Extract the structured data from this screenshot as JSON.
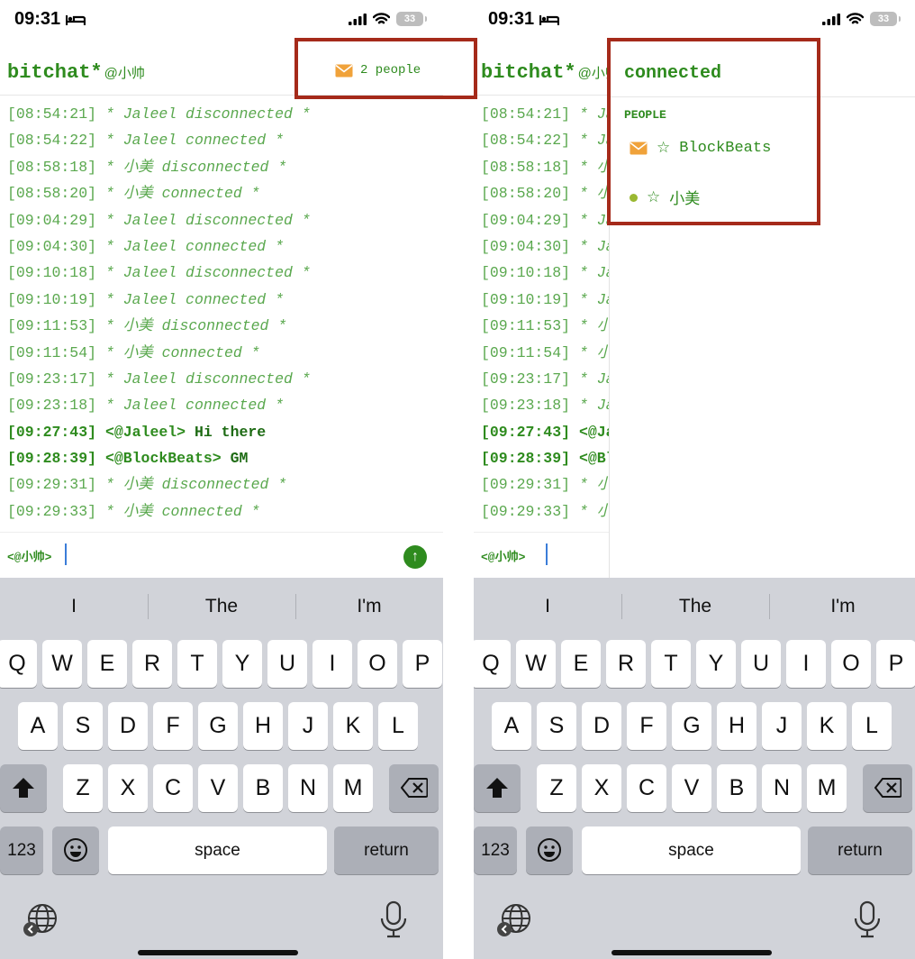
{
  "status": {
    "time": "09:31",
    "battery": "33"
  },
  "header": {
    "app_name": "bitchat*",
    "handle": "@小帅",
    "people_label": "2 people"
  },
  "messages": [
    {
      "ts": "[08:54:21]",
      "text": "* Jaleel disconnected *",
      "kind": "sys"
    },
    {
      "ts": "[08:54:22]",
      "text": "* Jaleel connected *",
      "kind": "sys"
    },
    {
      "ts": "[08:58:18]",
      "text": "* 小美 disconnected *",
      "kind": "sys"
    },
    {
      "ts": "[08:58:20]",
      "text": "* 小美 connected *",
      "kind": "sys"
    },
    {
      "ts": "[09:04:29]",
      "text": "* Jaleel disconnected *",
      "kind": "sys"
    },
    {
      "ts": "[09:04:30]",
      "text": "* Jaleel connected *",
      "kind": "sys"
    },
    {
      "ts": "[09:10:18]",
      "text": "* Jaleel disconnected *",
      "kind": "sys"
    },
    {
      "ts": "[09:10:19]",
      "text": "* Jaleel connected *",
      "kind": "sys"
    },
    {
      "ts": "[09:11:53]",
      "text": "* 小美 disconnected *",
      "kind": "sys"
    },
    {
      "ts": "[09:11:54]",
      "text": "* 小美 connected *",
      "kind": "sys"
    },
    {
      "ts": "[09:23:17]",
      "text": "* Jaleel disconnected *",
      "kind": "sys"
    },
    {
      "ts": "[09:23:18]",
      "text": "* Jaleel connected *",
      "kind": "sys"
    },
    {
      "ts": "[09:27:43]",
      "nick": "<@Jaleel>",
      "text": "Hi there",
      "kind": "chat"
    },
    {
      "ts": "[09:28:39]",
      "nick": "<@BlockBeats>",
      "text": "GM",
      "kind": "chat"
    },
    {
      "ts": "[09:29:31]",
      "text": "* 小美 disconnected *",
      "kind": "sys"
    },
    {
      "ts": "[09:29:33]",
      "text": "* 小美 connected *",
      "kind": "sys"
    }
  ],
  "input": {
    "prompt": "<@小帅>"
  },
  "suggestions": [
    "I",
    "The",
    "I'm"
  ],
  "keyboard": {
    "row1": [
      "Q",
      "W",
      "E",
      "R",
      "T",
      "Y",
      "U",
      "I",
      "O",
      "P"
    ],
    "row2": [
      "A",
      "S",
      "D",
      "F",
      "G",
      "H",
      "J",
      "K",
      "L"
    ],
    "row3": [
      "Z",
      "X",
      "C",
      "V",
      "B",
      "N",
      "M"
    ],
    "numbers": "123",
    "space": "space",
    "return": "return"
  },
  "sidebar": {
    "title": "connected",
    "section": "PEOPLE",
    "people": [
      {
        "name": "BlockBeats",
        "indicator": "envelope-icon"
      },
      {
        "name": "小美",
        "indicator": "online-dot"
      }
    ]
  },
  "colors": {
    "accent": "#2e8b1e",
    "highlight": "#a52a1a"
  }
}
